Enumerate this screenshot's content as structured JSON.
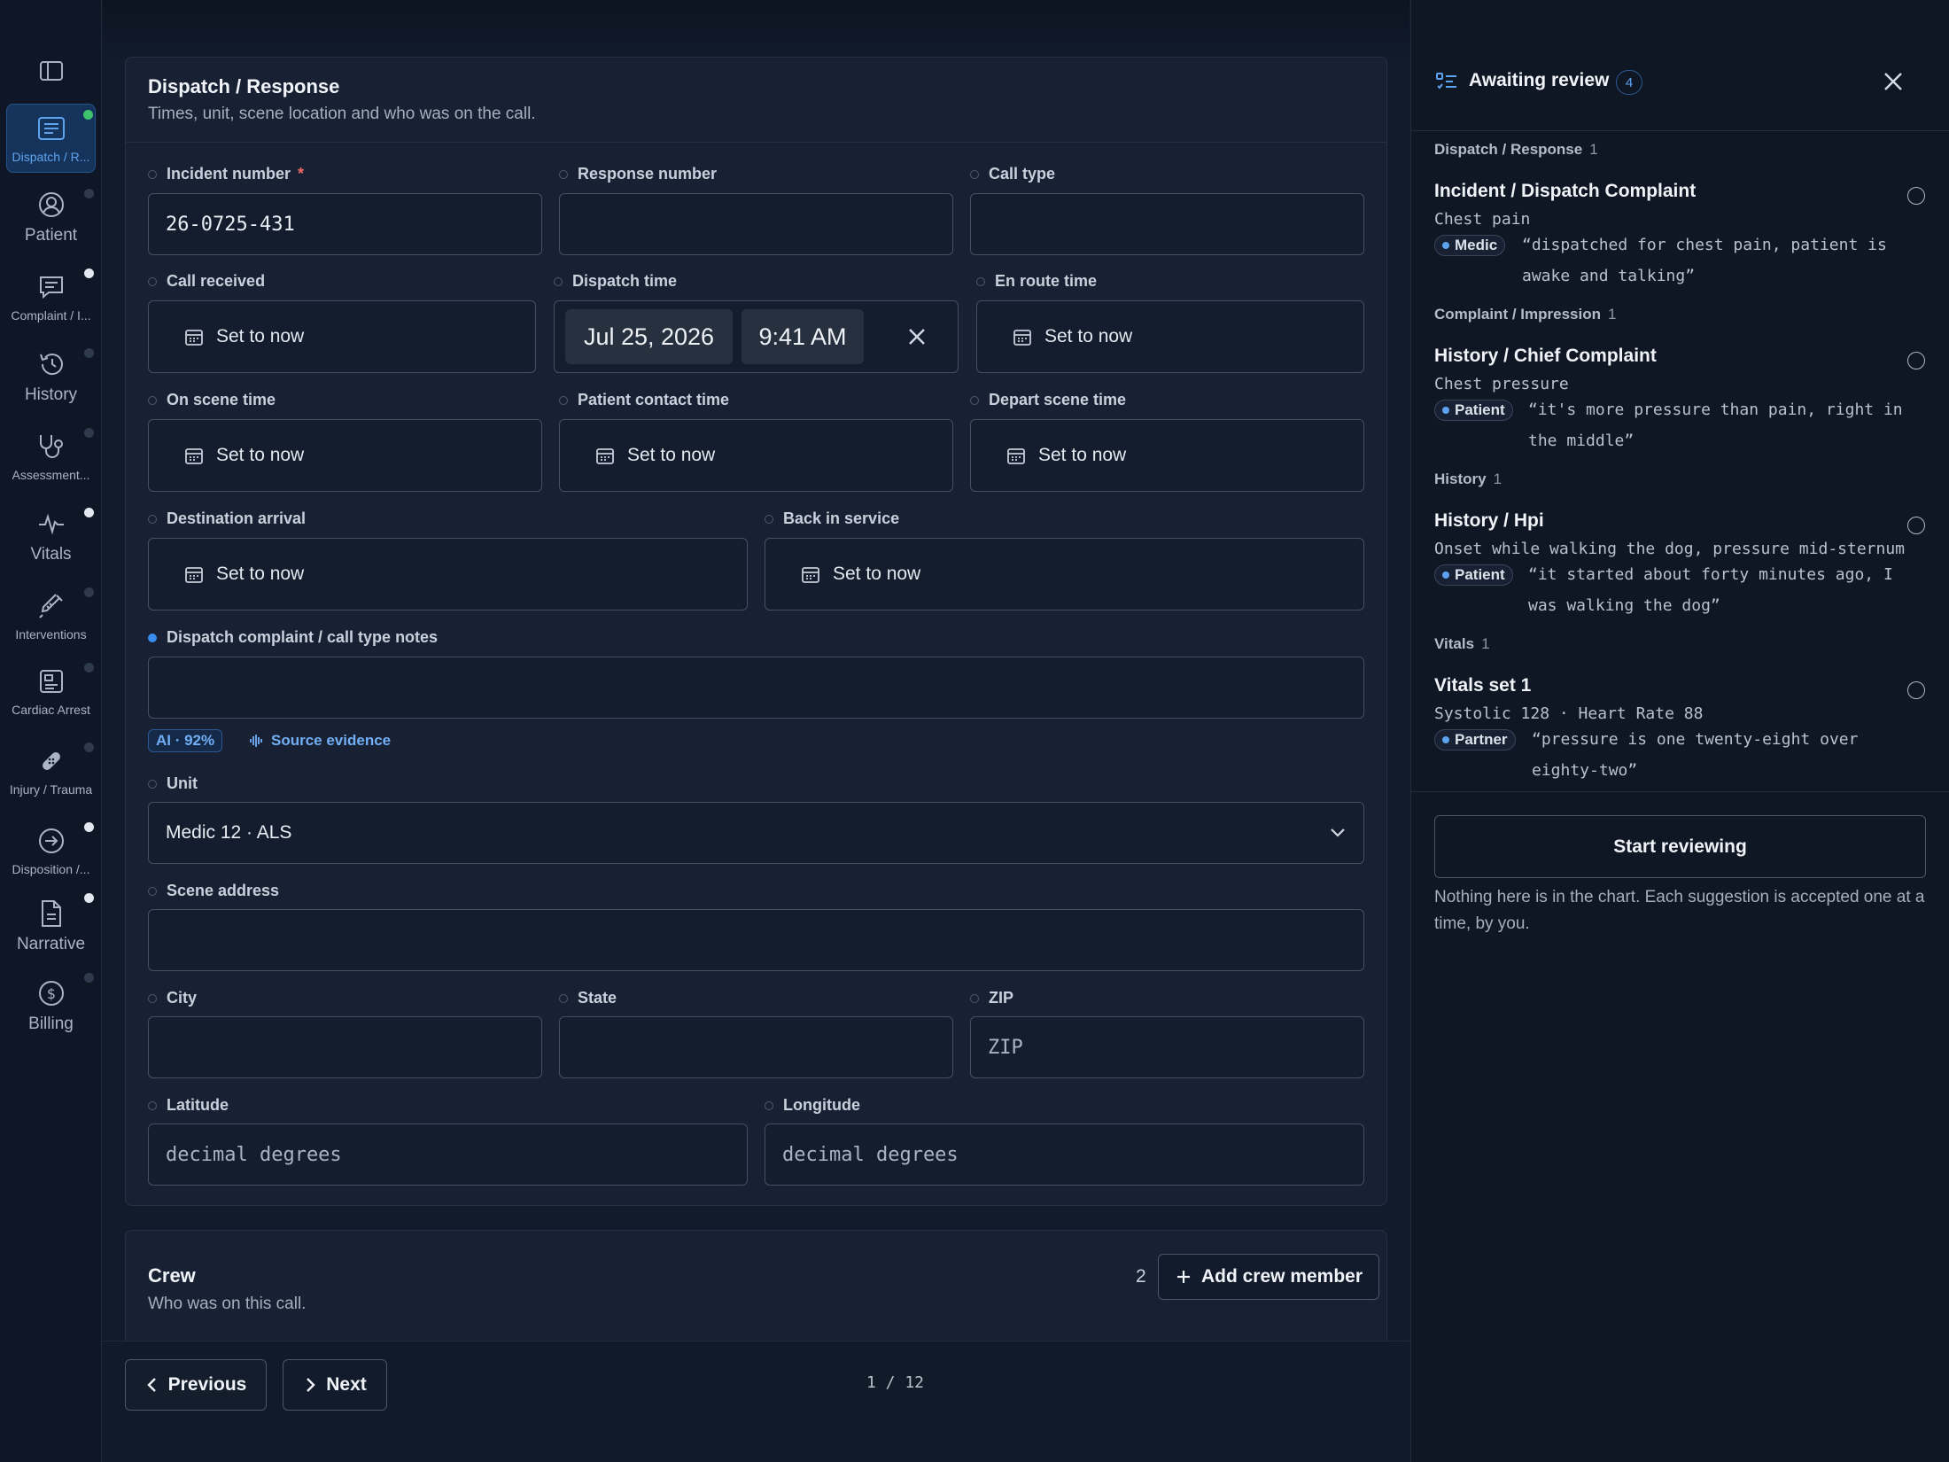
{
  "sidebar": {
    "items": [
      {
        "label": "Dispatch / R...",
        "icon": "list-icon",
        "status": "green"
      },
      {
        "label": "Patient",
        "icon": "user-circle-icon",
        "status": "muted"
      },
      {
        "label": "Complaint / I...",
        "icon": "message-icon",
        "status": "white"
      },
      {
        "label": "History",
        "icon": "history-icon",
        "status": "muted"
      },
      {
        "label": "Assessment...",
        "icon": "stethoscope-icon",
        "status": "muted"
      },
      {
        "label": "Vitals",
        "icon": "pulse-icon",
        "status": "white"
      },
      {
        "label": "Interventions",
        "icon": "syringe-icon",
        "status": "muted"
      },
      {
        "label": "Cardiac Arrest",
        "icon": "monitor-icon",
        "status": "muted"
      },
      {
        "label": "Injury / Trauma",
        "icon": "bandage-icon",
        "status": "muted"
      },
      {
        "label": "Disposition /...",
        "icon": "arrow-circle-icon",
        "status": "white"
      },
      {
        "label": "Narrative",
        "icon": "document-icon",
        "status": "white"
      },
      {
        "label": "Billing",
        "icon": "dollar-icon",
        "status": "muted"
      }
    ]
  },
  "section": {
    "title": "Dispatch / Response",
    "subtitle": "Times, unit, scene location and who was on the call."
  },
  "fields": {
    "incident_number": {
      "label": "Incident number",
      "required_mark": "*",
      "value": "26-0725-431"
    },
    "response_number": {
      "label": "Response number",
      "value": ""
    },
    "call_type": {
      "label": "Call type",
      "value": ""
    },
    "call_received": {
      "label": "Call received",
      "value": "Set to now"
    },
    "dispatch_time": {
      "label": "Dispatch time",
      "date": "Jul 25, 2026",
      "time": "9:41 AM"
    },
    "en_route_time": {
      "label": "En route time",
      "value": "Set to now"
    },
    "on_scene_time": {
      "label": "On scene time",
      "value": "Set to now"
    },
    "patient_contact_time": {
      "label": "Patient contact time",
      "value": "Set to now"
    },
    "depart_scene_time": {
      "label": "Depart scene time",
      "value": "Set to now"
    },
    "destination_arrival": {
      "label": "Destination arrival",
      "value": "Set to now"
    },
    "back_in_service": {
      "label": "Back in service",
      "value": "Set to now"
    },
    "dispatch_notes": {
      "label": "Dispatch complaint / call type notes",
      "value": ""
    },
    "ai_badge": "AI · 92%",
    "source_evidence": "Source evidence",
    "unit": {
      "label": "Unit",
      "value": "Medic 12 · ALS"
    },
    "scene_address": {
      "label": "Scene address",
      "value": ""
    },
    "city": {
      "label": "City",
      "value": ""
    },
    "state": {
      "label": "State",
      "value": ""
    },
    "zip": {
      "label": "ZIP",
      "placeholder": "ZIP"
    },
    "latitude": {
      "label": "Latitude",
      "placeholder": "decimal degrees"
    },
    "longitude": {
      "label": "Longitude",
      "placeholder": "decimal degrees"
    }
  },
  "crew": {
    "title": "Crew",
    "subtitle": "Who was on this call.",
    "count": "2",
    "add_label": "Add crew member"
  },
  "footer": {
    "previous_label": "Previous",
    "next_label": "Next",
    "pager": "1 / 12"
  },
  "review_panel": {
    "title": "Awaiting review",
    "count": "4",
    "groups": [
      {
        "label": "Dispatch / Response",
        "count": "1",
        "title": "Incident / Dispatch Complaint",
        "value": "Chest pain",
        "speaker": "Medic",
        "quote_line1": "“dispatched for chest pain, patient is",
        "quote_line2": "awake and talking”"
      },
      {
        "label": "Complaint / Impression",
        "count": "1",
        "title": "History / Chief Complaint",
        "value": "Chest pressure",
        "speaker": "Patient",
        "quote_line1": "“it's more pressure than pain, right in",
        "quote_line2": "the middle”"
      },
      {
        "label": "History",
        "count": "1",
        "title": "History / Hpi",
        "value": "Onset while walking the dog, pressure mid-sternum",
        "speaker": "Patient",
        "quote_line1": "“it started about forty minutes ago, I",
        "quote_line2": "was walking the dog”"
      },
      {
        "label": "Vitals",
        "count": "1",
        "title": "Vitals set 1",
        "value": "Systolic 128 · Heart Rate 88",
        "speaker": "Partner",
        "quote_line1": "“pressure is one twenty-eight over",
        "quote_line2": "eighty-two”"
      }
    ],
    "start_label": "Start reviewing",
    "note": "Nothing here is in the chart. Each suggestion is accepted one at a time, by you."
  },
  "colors": {
    "accent": "#3b8cf0",
    "background": "#111a2a",
    "card": "#172133",
    "status_green": "#3ec46d"
  }
}
